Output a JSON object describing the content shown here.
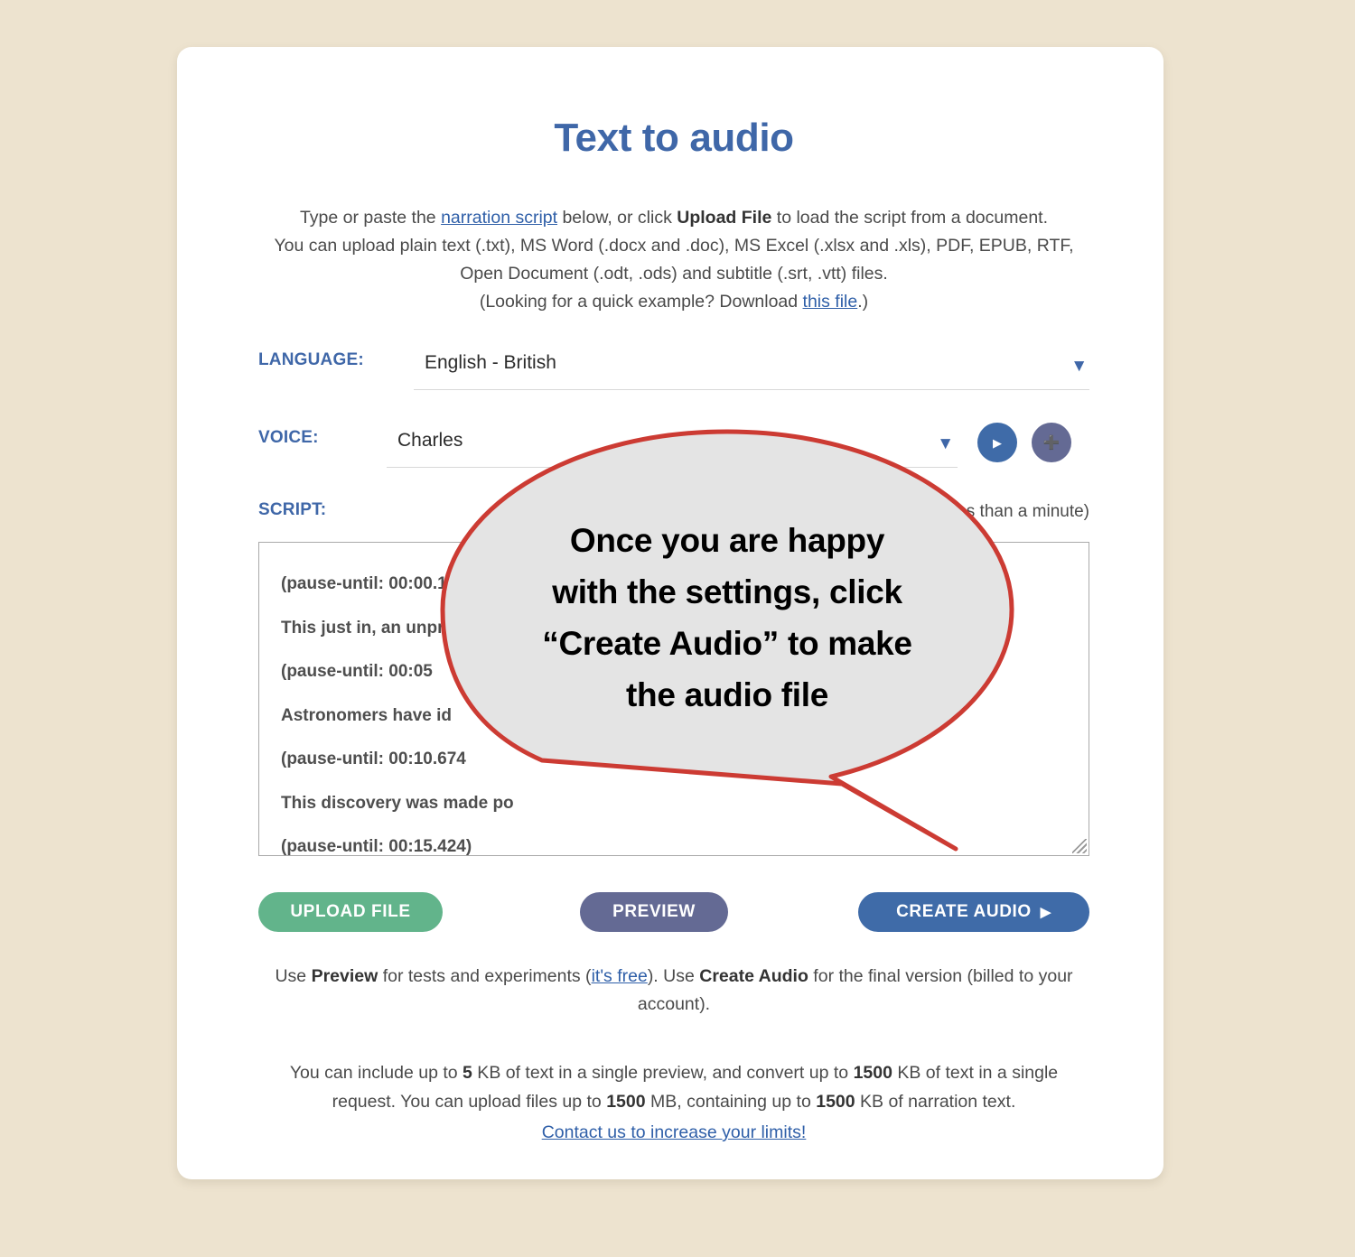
{
  "page": {
    "background_color": "#ede3cf",
    "card_background": "#ffffff"
  },
  "header": {
    "title": "Text to audio",
    "title_color": "#3f67a8"
  },
  "intro": {
    "line1_a": "Type or paste the ",
    "line1_link": "narration script",
    "line1_b": " below, or click ",
    "line1_bold": "Upload File",
    "line1_c": " to load the script from a document.",
    "line2": "You can upload plain text (.txt), MS Word (.docx and .doc), MS Excel (.xlsx and .xls), PDF, EPUB, RTF,",
    "line3": "Open Document (.odt, .ods) and subtitle (.srt, .vtt) files.",
    "line4_a": "(Looking for a quick example? Download ",
    "line4_link": "this file",
    "line4_b": ".)"
  },
  "form": {
    "language": {
      "label": "LANGUAGE:",
      "value": "English - British",
      "caret": "chevron-down-icon"
    },
    "voice": {
      "label": "VOICE:",
      "value": "Charles",
      "caret": "chevron-down-icon",
      "play_glyph": "▶",
      "add_glyph": "＋",
      "play_color": "#3f6ba8",
      "add_color": "#646a94"
    },
    "script": {
      "label": "SCRIPT:",
      "duration_hint": "less than a minute)",
      "lines": [
        "(pause-until: 00:00.100)",
        "This just in, an unpre",
        "(pause-until: 00:05",
        "Astronomers have id",
        "(pause-until: 00:10.674",
        "This discovery was made po",
        "(pause-until: 00:15.424)"
      ]
    }
  },
  "buttons": {
    "upload": {
      "label": "UPLOAD FILE",
      "color": "#62b48b"
    },
    "preview": {
      "label": "PREVIEW",
      "color": "#646a94"
    },
    "create": {
      "label": "CREATE AUDIO",
      "glyph": "▶",
      "color": "#3f6ba8"
    }
  },
  "note": {
    "a": "Use ",
    "b1": "Preview",
    "c": " for tests and experiments (",
    "link": "it's free",
    "d": "). Use ",
    "b2": "Create Audio",
    "e": " for the final version (billed to your account)."
  },
  "limits": {
    "a": "You can include up to ",
    "n1": "5",
    "b": " KB of text in a single preview, and convert up to ",
    "n2": "1500",
    "c": " KB of text in a single request. You can upload files up to ",
    "n3": "1500",
    "d": " MB, containing up to ",
    "n4": "1500",
    "e": " KB of narration text.",
    "contact_link": "Contact us to increase your limits!"
  },
  "callout": {
    "line1": "Once you are happy",
    "line2": "with the settings, click",
    "line3": "“Create Audio” to make",
    "line4": "the audio file",
    "fill": "#e4e4e4",
    "stroke": "#cc3b33"
  }
}
